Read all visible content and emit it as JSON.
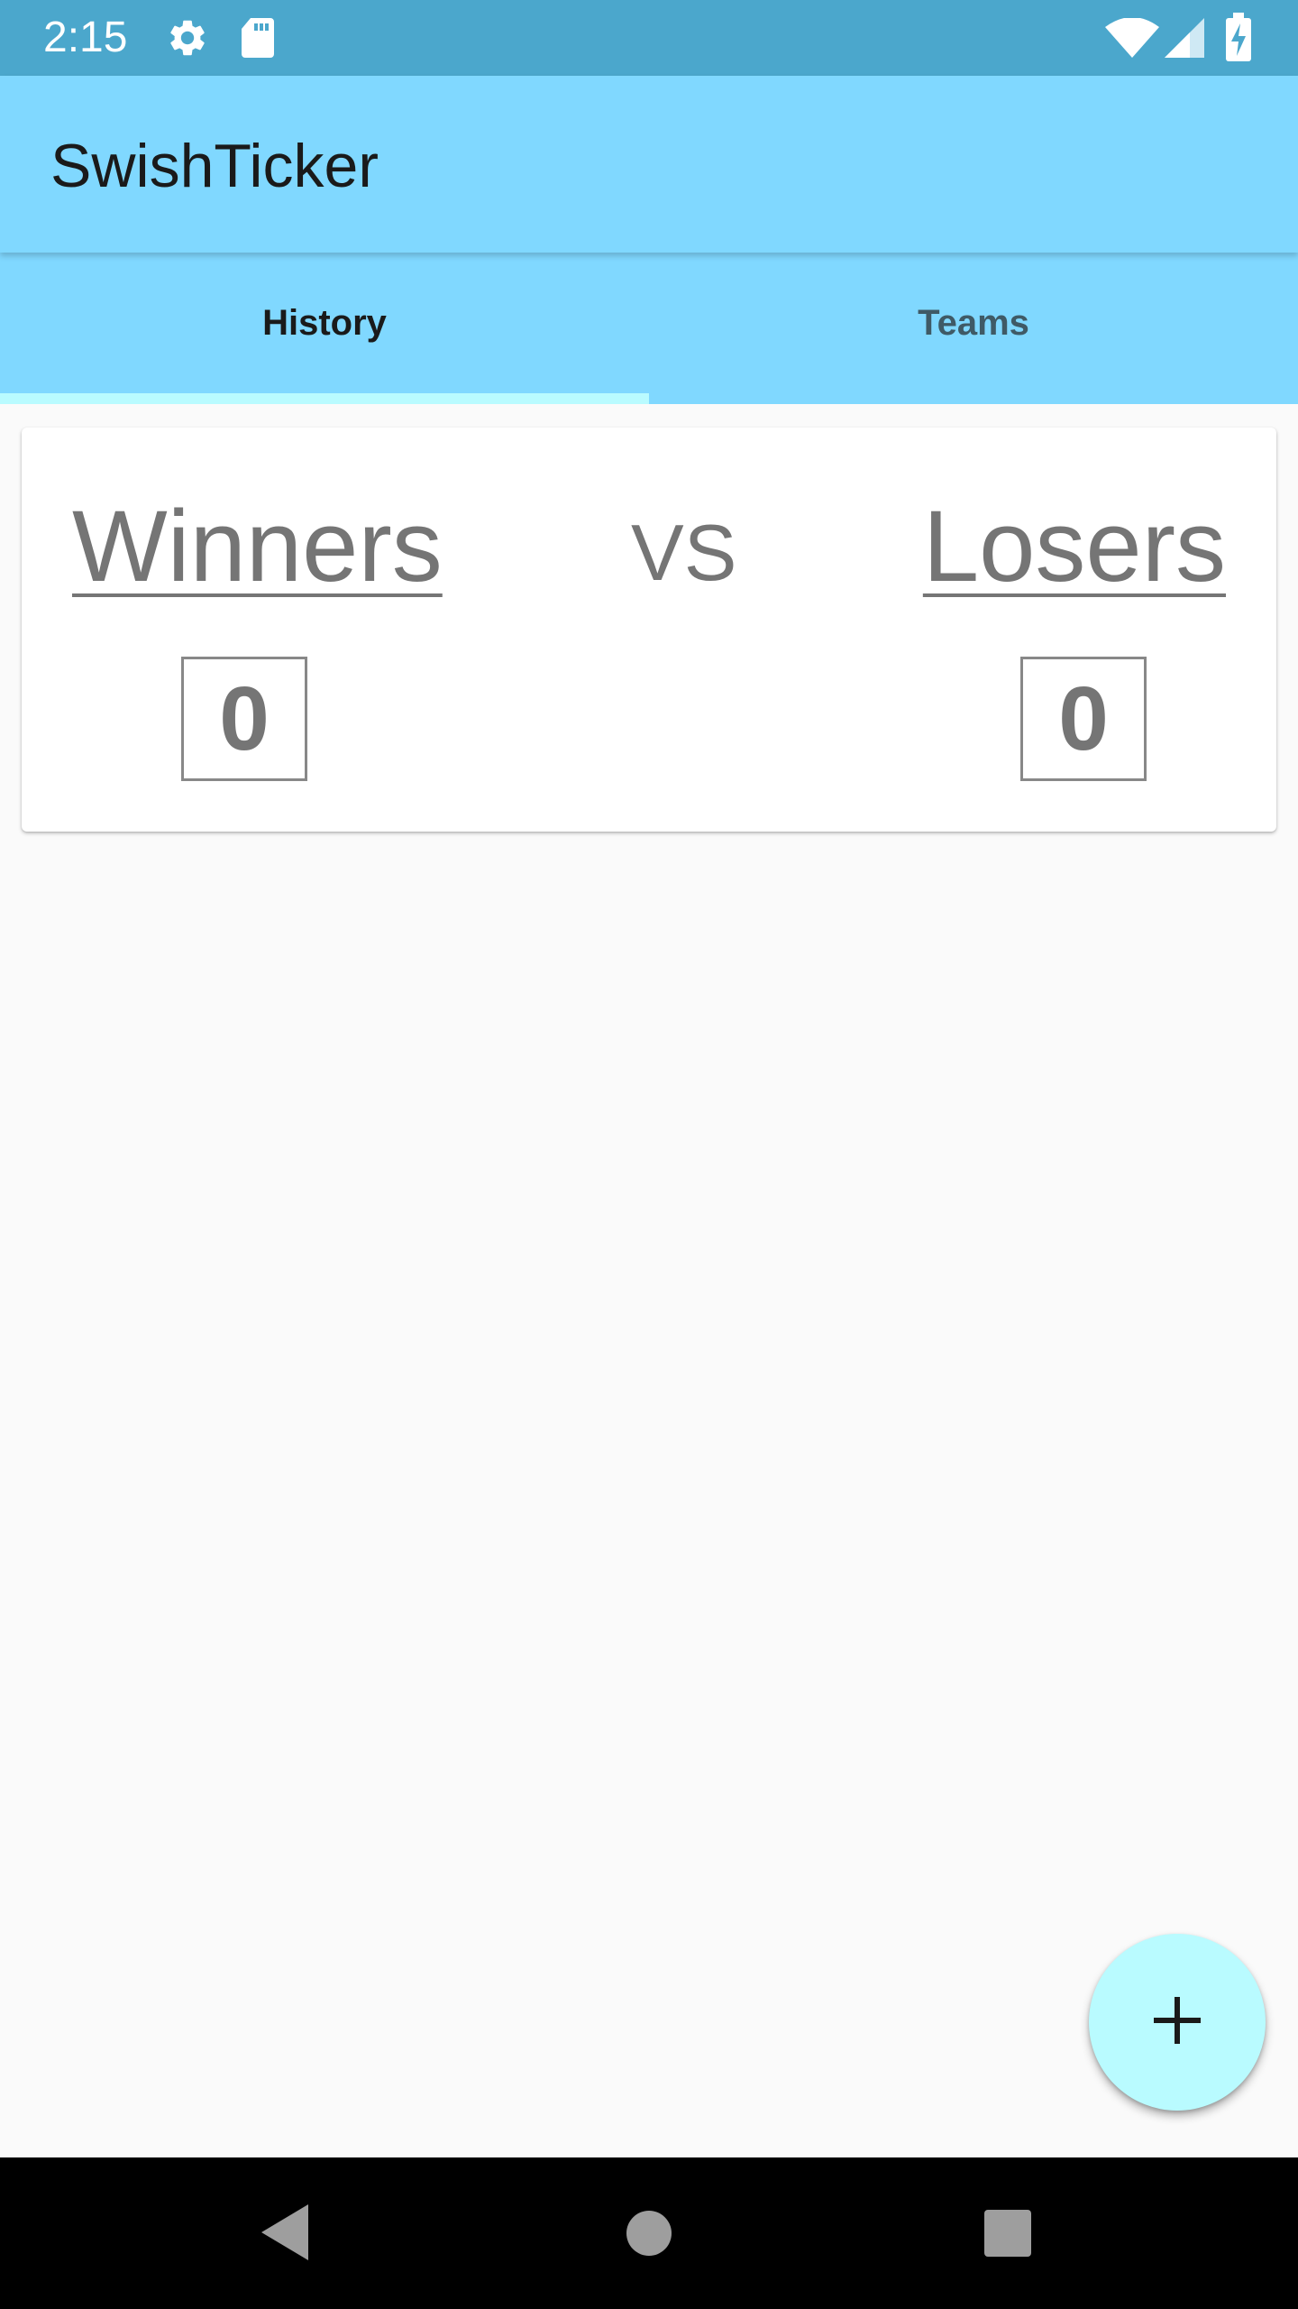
{
  "status_bar": {
    "time": "2:15",
    "icons": [
      "gear-icon",
      "sd-card-icon",
      "wifi-icon",
      "cell-signal-icon",
      "battery-charging-icon"
    ]
  },
  "app_bar": {
    "title": "SwishTicker"
  },
  "tabs": [
    {
      "label": "History",
      "active": true
    },
    {
      "label": "Teams",
      "active": false
    }
  ],
  "match": {
    "home_team": "Winners",
    "vs": "VS",
    "away_team": "Losers",
    "home_score": "0",
    "away_score": "0"
  },
  "fab": {
    "icon": "plus-icon"
  },
  "navigation": {
    "buttons": [
      "back-icon",
      "home-icon",
      "recents-icon"
    ]
  },
  "colors": {
    "status_bar": "#4ba7cc",
    "app_bar": "#80d8ff",
    "tab_indicator": "#b9fbff",
    "fab": "#b9fbff",
    "text_grey": "#757575"
  }
}
